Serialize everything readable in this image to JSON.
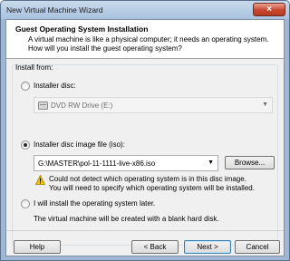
{
  "window": {
    "title": "New Virtual Machine Wizard",
    "close_glyph": "×"
  },
  "header": {
    "title": "Guest Operating System Installation",
    "description": "A virtual machine is like a physical computer; it needs an operating system. How will you install the guest operating system?"
  },
  "install_from": {
    "label": "Install from:",
    "options": {
      "disc": {
        "label": "Installer disc:",
        "selected": false,
        "drive_value": "DVD RW Drive (E:)"
      },
      "iso": {
        "label": "Installer disc image file (iso):",
        "selected": true,
        "path_value": "G:\\MASTER\\pol-11-1111-live-x86.iso",
        "browse_label": "Browse...",
        "warning_line1": "Could not detect which operating system is in this disc image.",
        "warning_line2": "You will need to specify which operating system will be installed."
      },
      "later": {
        "label": "I will install the operating system later.",
        "selected": false,
        "note": "The virtual machine will be created with a blank hard disk."
      }
    }
  },
  "footer": {
    "help_label": "Help",
    "back_label": "< Back",
    "next_label": "Next >",
    "cancel_label": "Cancel"
  },
  "icons": {
    "warning": "warning-icon",
    "dvd": "dvd-drive-icon",
    "dropdown": "chevron-down-icon"
  },
  "colors": {
    "warning": "#f2c200",
    "title_bar": "#b4cbe4",
    "close_button": "#c8472f"
  }
}
